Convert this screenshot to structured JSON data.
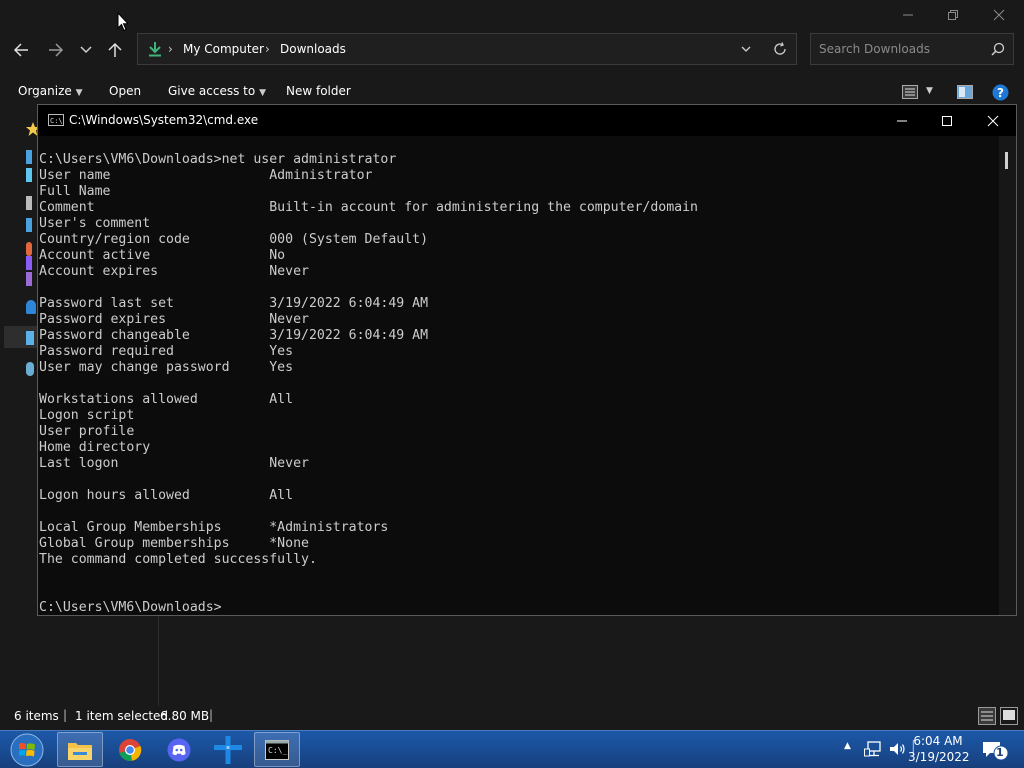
{
  "explorer": {
    "breadcrumb": [
      "My Computer",
      "Downloads"
    ],
    "search_placeholder": "Search Downloads",
    "toolbar": {
      "organize": "Organize",
      "open": "Open",
      "give_access": "Give access to",
      "new_folder": "New folder"
    },
    "status": {
      "items": "6 items",
      "selected": "1 item selected",
      "size": "6.80 MB"
    }
  },
  "cmd": {
    "title": "C:\\Windows\\System32\\cmd.exe",
    "lines": [
      "C:\\Users\\VM6\\Downloads>net user administrator",
      "User name                    Administrator",
      "Full Name",
      "Comment                      Built-in account for administering the computer/domain",
      "User's comment",
      "Country/region code          000 (System Default)",
      "Account active               No",
      "Account expires              Never",
      "",
      "Password last set            3/19/2022 6:04:49 AM",
      "Password expires             Never",
      "Password changeable          3/19/2022 6:04:49 AM",
      "Password required            Yes",
      "User may change password     Yes",
      "",
      "Workstations allowed         All",
      "Logon script",
      "User profile",
      "Home directory",
      "Last logon                   Never",
      "",
      "Logon hours allowed          All",
      "",
      "Local Group Memberships      *Administrators",
      "Global Group memberships     *None",
      "The command completed successfully.",
      "",
      "",
      "C:\\Users\\VM6\\Downloads>"
    ]
  },
  "taskbar": {
    "time": "6:04 AM",
    "date": "3/19/2022",
    "notification_count": "1"
  }
}
